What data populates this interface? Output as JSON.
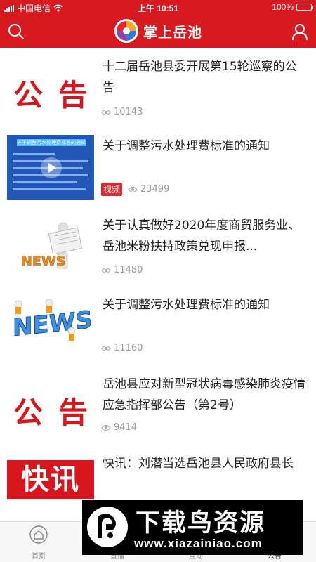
{
  "status_bar": {
    "carrier": "中国电信",
    "time": "上午 10:51",
    "battery": "100%"
  },
  "header": {
    "title": "掌上岳池"
  },
  "articles": [
    {
      "title": "十二届岳池县委开展第15轮巡察的公告",
      "views": "10143",
      "thumb": "gonggao",
      "thumb_text": [
        "公",
        "告"
      ]
    },
    {
      "title": "关于调整污水处理费标准的通知",
      "views": "23499",
      "thumb": "video",
      "tag": "视频",
      "thumb_text": [
        "关于调整污水处理费标准的通知"
      ]
    },
    {
      "title": "关于认真做好2020年度商贸服务业、岳池米粉扶持政策兑现申报...",
      "views": "11480",
      "thumb": "news-reader",
      "thumb_text": [
        "NEWS"
      ]
    },
    {
      "title": "关于调整污水处理费标准的通知",
      "views": "11160",
      "thumb": "news-3d",
      "thumb_text": [
        "NEWS"
      ]
    },
    {
      "title": "岳池县应对新型冠状病毒感染肺炎疫情 应急指挥部公告（第2号）",
      "views": "9414",
      "thumb": "gonggao",
      "thumb_text": [
        "公",
        "告"
      ]
    },
    {
      "title": "快讯：刘潜当选岳池县人民政府县长",
      "views": "",
      "thumb": "kuaixun",
      "thumb_text": [
        "快讯"
      ]
    }
  ],
  "tabbar": {
    "items": [
      {
        "label": "首页",
        "icon": "home-icon"
      },
      {
        "label": "直播",
        "icon": "live-icon"
      },
      {
        "label": "互动",
        "icon": "interact-icon"
      },
      {
        "label": "公告",
        "icon": "notice-icon"
      }
    ]
  },
  "watermark": {
    "name": "下载鸟资源",
    "url": "www.xiazainiao.com"
  },
  "colors": {
    "brand_red": "#d81a20",
    "view_gray": "#9a9a9a",
    "tag_red": "#e0262e"
  }
}
